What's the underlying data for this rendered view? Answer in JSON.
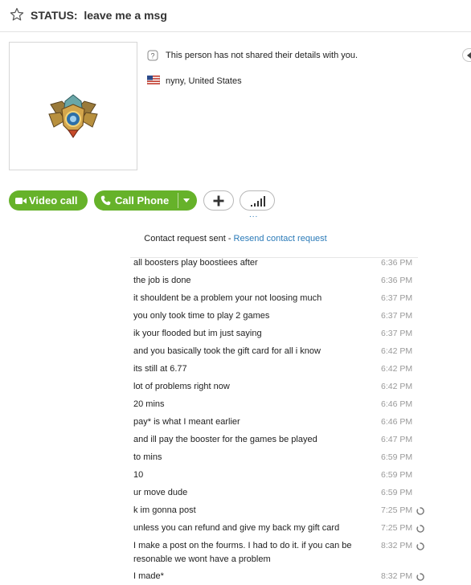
{
  "header": {
    "status_label": "STATUS:",
    "status_message": "leave me a msg"
  },
  "profile": {
    "shared_notice": "This person has not shared their details with you.",
    "location": "nyny, United States"
  },
  "actions": {
    "video_call": "Video call",
    "call_phone": "Call Phone",
    "more": "..."
  },
  "request": {
    "prefix": "Contact request sent - ",
    "link": "Resend contact request"
  },
  "messages": [
    {
      "text": "all boosters play boostiees after",
      "time": "6:36 PM",
      "pending": false
    },
    {
      "text": "the job is done",
      "time": "6:36 PM",
      "pending": false
    },
    {
      "text": "it shouldent be a problem your not loosing much",
      "time": "6:37 PM",
      "pending": false
    },
    {
      "text": "you only took time to play 2 games",
      "time": "6:37 PM",
      "pending": false
    },
    {
      "text": "ik your flooded but im just saying",
      "time": "6:37 PM",
      "pending": false
    },
    {
      "text": "and you basically took the gift card for all i know",
      "time": "6:42 PM",
      "pending": false
    },
    {
      "text": "its still at 6.77",
      "time": "6:42 PM",
      "pending": false
    },
    {
      "text": "lot of problems right now",
      "time": "6:42 PM",
      "pending": false
    },
    {
      "text": "20 mins",
      "time": "6:46 PM",
      "pending": false
    },
    {
      "text": "pay* is what I meant earlier",
      "time": "6:46 PM",
      "pending": false
    },
    {
      "text": "and ill pay the booster for the games be played",
      "time": "6:47 PM",
      "pending": false
    },
    {
      "text": "to mins",
      "time": "6:59 PM",
      "pending": false
    },
    {
      "text": "10",
      "time": "6:59 PM",
      "pending": false
    },
    {
      "text": "ur move dude",
      "time": "6:59 PM",
      "pending": false
    },
    {
      "text": "k im gonna post",
      "time": "7:25 PM",
      "pending": true
    },
    {
      "text": "unless you can refund and give my back my gift card",
      "time": "7:25 PM",
      "pending": true
    },
    {
      "text": "I make a post on the fourms. I had to do it. if you can be resonable we wont have a problem",
      "time": "8:32 PM",
      "pending": true
    },
    {
      "text": "I made*",
      "time": "8:32 PM",
      "pending": true
    }
  ]
}
